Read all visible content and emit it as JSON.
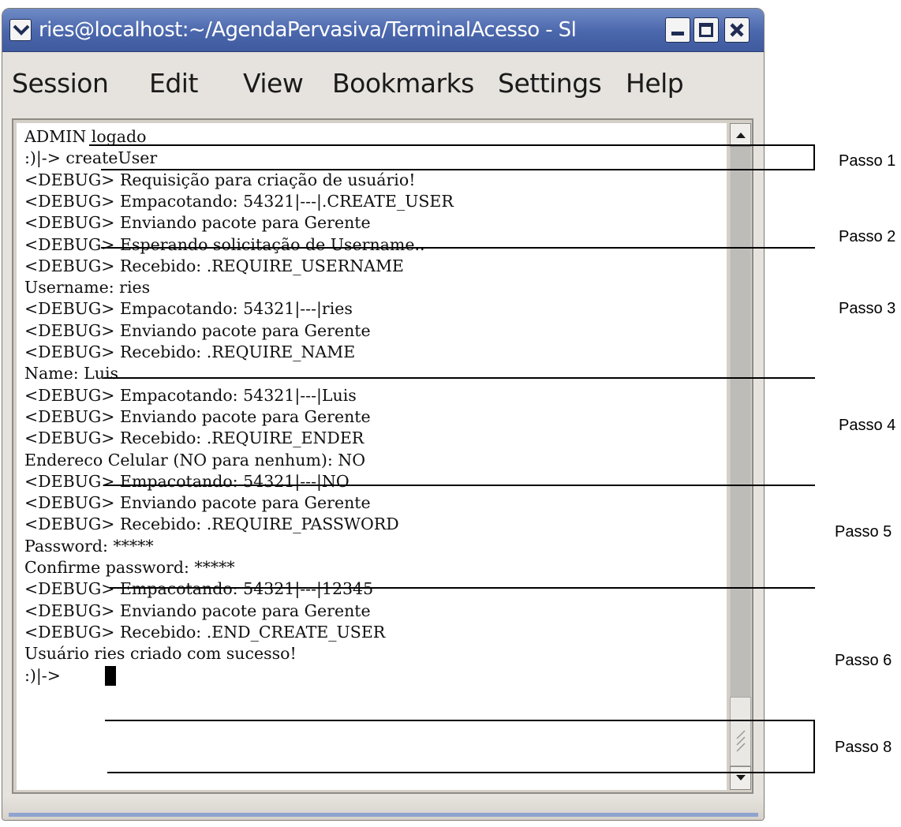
{
  "window": {
    "title": "ries@localhost:~/AgendaPervasiva/TerminalAcesso - Sl",
    "titlebar_color": "#4b67ac",
    "buttons": [
      "window-menu-icon",
      "minimize-icon",
      "maximize-icon",
      "close-icon"
    ]
  },
  "menubar": {
    "items": [
      "Session",
      "Edit",
      "View",
      "Bookmarks",
      "Settings",
      "Help"
    ]
  },
  "terminal": {
    "lines": [
      "ADMIN logado",
      ":)|-> createUser",
      "<DEBUG> Requisição para criação de usuário!",
      "<DEBUG> Empacotando: 54321|---|.CREATE_USER",
      "<DEBUG> Enviando pacote para Gerente",
      "<DEBUG> Esperando solicitação de Username..",
      "<DEBUG> Recebido: .REQUIRE_USERNAME",
      "Username: ries",
      "<DEBUG> Empacotando: 54321|---|ries",
      "<DEBUG> Enviando pacote para Gerente",
      "<DEBUG> Recebido: .REQUIRE_NAME",
      "Name: Luis",
      "<DEBUG> Empacotando: 54321|---|Luis",
      "<DEBUG> Enviando pacote para Gerente",
      "<DEBUG> Recebido: .REQUIRE_ENDER",
      "Endereco Celular (NO para nenhum): NO",
      "<DEBUG> Empacotando: 54321|---|NO",
      "<DEBUG> Enviando pacote para Gerente",
      "<DEBUG> Recebido: .REQUIRE_PASSWORD",
      "Password: *****",
      "Confirme password: *****",
      "<DEBUG> Empacotando: 54321|---|12345",
      "<DEBUG> Enviando pacote para Gerente",
      "<DEBUG> Recebido: .END_CREATE_USER",
      "Usuário ries criado com sucesso!",
      ":)|-> "
    ]
  },
  "annotations": {
    "steps": [
      "Passo 1",
      "Passo 2",
      "Passo 3",
      "Passo 4",
      "Passo 5",
      "Passo 6",
      "Passo 8"
    ]
  }
}
